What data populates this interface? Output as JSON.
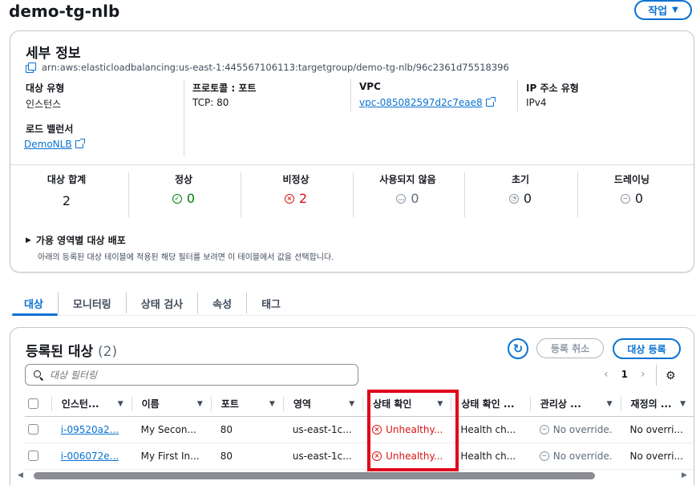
{
  "header": {
    "title": "demo-tg-nlb",
    "action_label": "작업",
    "action_caret": "▼"
  },
  "details": {
    "title": "세부 정보",
    "arn": "arn:aws:elasticloadbalancing:us-east-1:445567106113:targetgroup/demo-tg-nlb/96c2361d75518396",
    "fields": {
      "target_type_label": "대상 유형",
      "target_type_value": "인스턴스",
      "protocol_label": "프로토콜 : 포트",
      "protocol_value": "TCP: 80",
      "vpc_label": "VPC",
      "vpc_value": "vpc-085082597d2c7eae8",
      "ip_type_label": "IP 주소 유형",
      "ip_type_value": "IPv4",
      "lb_label": "로드 밸런서",
      "lb_value": "DemoNLB"
    },
    "stats": [
      {
        "label": "대상 합계",
        "value": "2",
        "icon": ""
      },
      {
        "label": "정상",
        "value": "0",
        "icon": "check-circle-icon"
      },
      {
        "label": "비정상",
        "value": "2",
        "icon": "error-circle-icon"
      },
      {
        "label": "사용되지 않음",
        "value": "0",
        "icon": "unused-circle-icon"
      },
      {
        "label": "초기",
        "value": "0",
        "icon": "clock-circle-icon"
      },
      {
        "label": "드레이닝",
        "value": "0",
        "icon": "minus-circle-icon"
      }
    ],
    "az_title": "가용 영역별 대상 배포",
    "az_desc": "아래의 등록된 대상 테이블에 적용된 해당 필터를 보려면 이 테이블에서 값을 선택합니다."
  },
  "tabs": [
    "대상",
    "모니터링",
    "상태 검사",
    "속성",
    "태그"
  ],
  "targets": {
    "title": "등록된 대상",
    "count": "(2)",
    "deregister_label": "등록 취소",
    "register_label": "대상 등록",
    "filter_placeholder": "대상 필터링",
    "page": "1",
    "columns": [
      "인스턴...",
      "이름",
      "포트",
      "영역",
      "상태 확인",
      "상태 확인 ...",
      "관리상 ...",
      "재정의 ..."
    ],
    "rows": [
      {
        "instance": "i-09520a2...",
        "name": "My Secon...",
        "port": "80",
        "zone": "us-east-1c...",
        "health": "Unhealthy...",
        "health_detail": "Health ch...",
        "admin": "No override.",
        "override": "No overri..."
      },
      {
        "instance": "i-006072e...",
        "name": "My First In...",
        "port": "80",
        "zone": "us-east-1c...",
        "health": "Unhealthy...",
        "health_detail": "Health ch...",
        "admin": "No override.",
        "override": "No overri..."
      }
    ]
  },
  "colors": {
    "accent": "#0972d3",
    "error": "#d91515",
    "success": "#037f0c",
    "highlight_box": "#e0001a"
  }
}
